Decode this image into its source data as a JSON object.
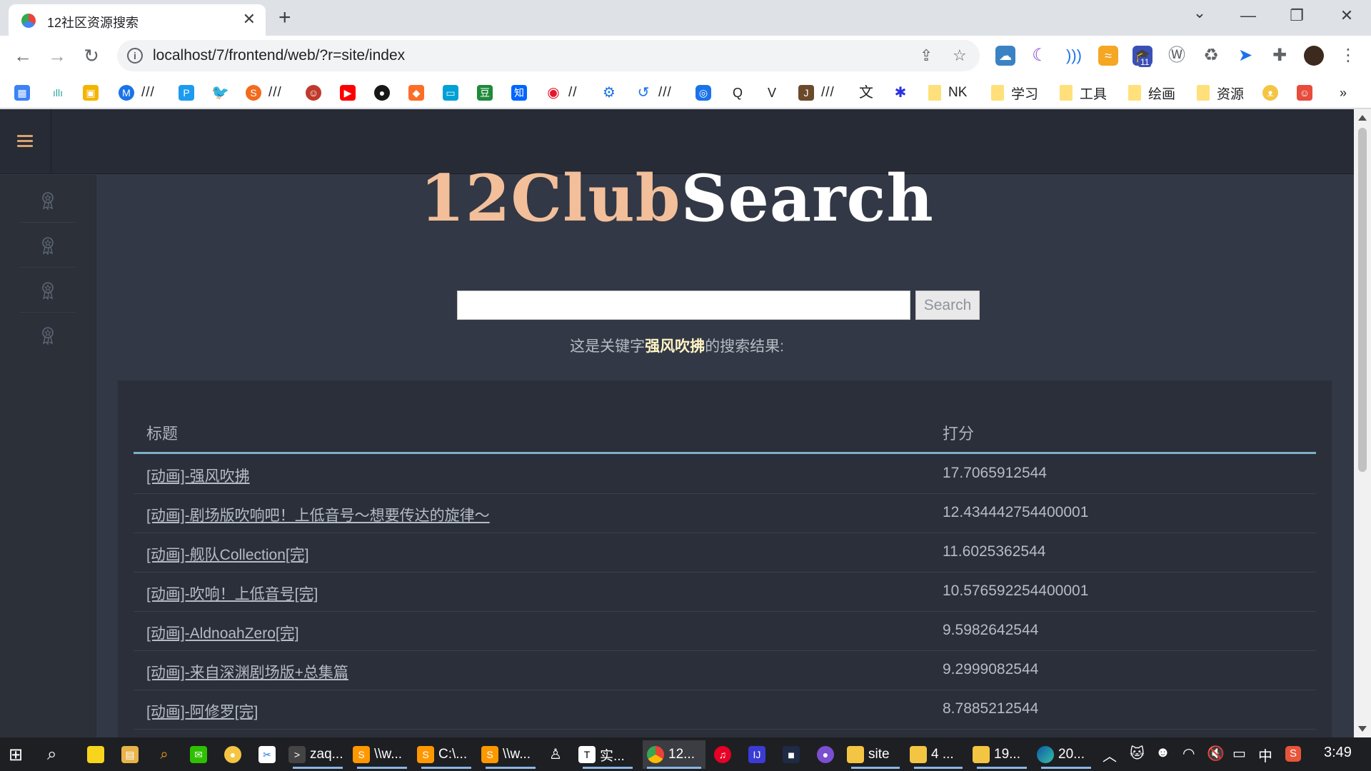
{
  "browser": {
    "tab_title": "12社区资源搜索",
    "tab_close": "✕",
    "new_tab": "+",
    "url": "localhost/7/frontend/web/?r=site/index",
    "window_controls": {
      "tabs_menu": "⌄",
      "minimize": "—",
      "restore": "❐",
      "close": "✕"
    },
    "nav": {
      "back": "←",
      "forward": "→",
      "reload": "↻",
      "menu": "⋮"
    },
    "extension_badge": "11",
    "bookmarks": [
      {
        "label": "///"
      },
      {
        "label": "///"
      },
      {
        "label": "//"
      },
      {
        "label": "///"
      },
      {
        "label": "///"
      },
      {
        "label": "NK"
      },
      {
        "label": "学习"
      },
      {
        "label": "工具"
      },
      {
        "label": "绘画"
      },
      {
        "label": "资源"
      },
      {
        "label": "»"
      }
    ]
  },
  "site": {
    "logo_part1": "12Club",
    "logo_part2": "Search",
    "search_value": "",
    "search_button": "Search",
    "result_prefix": "这是关键字",
    "result_keyword": "强风吹拂",
    "result_suffix": "的搜索结果:",
    "table": {
      "headers": [
        "标题",
        "打分"
      ],
      "rows": [
        {
          "title": "[动画]-强风吹拂",
          "score": "17.7065912544"
        },
        {
          "title": "[动画]-剧场版吹响吧！上低音号～想要传达的旋律～",
          "score": "12.434442754400001"
        },
        {
          "title": "[动画]-舰队Collection[完]",
          "score": "11.6025362544"
        },
        {
          "title": "[动画]-吹响！上低音号[完]",
          "score": "10.576592254400001"
        },
        {
          "title": "[动画]-AldnoahZero[完]",
          "score": "9.5982642544"
        },
        {
          "title": "[动画]-来自深渊剧场版+总集篇",
          "score": "9.2999082544"
        },
        {
          "title": "[动画]-阿修罗[完]",
          "score": "8.7885212544"
        }
      ]
    }
  },
  "taskbar": {
    "items": [
      {
        "label": "zaq..."
      },
      {
        "label": "\\\\w..."
      },
      {
        "label": "C:\\..."
      },
      {
        "label": "\\\\w..."
      },
      {
        "label": "实..."
      },
      {
        "label": "12..."
      },
      {
        "label": "site"
      },
      {
        "label": "4 ..."
      },
      {
        "label": "19..."
      },
      {
        "label": "20..."
      }
    ],
    "ime": "中",
    "clock": "3:49"
  },
  "colors": {
    "page_bg": "#323845",
    "topnav_bg": "#262b35",
    "panel_bg": "#2a2f3a",
    "logo_accent": "#f2bf9a",
    "header_line": "#7fb0c8"
  }
}
